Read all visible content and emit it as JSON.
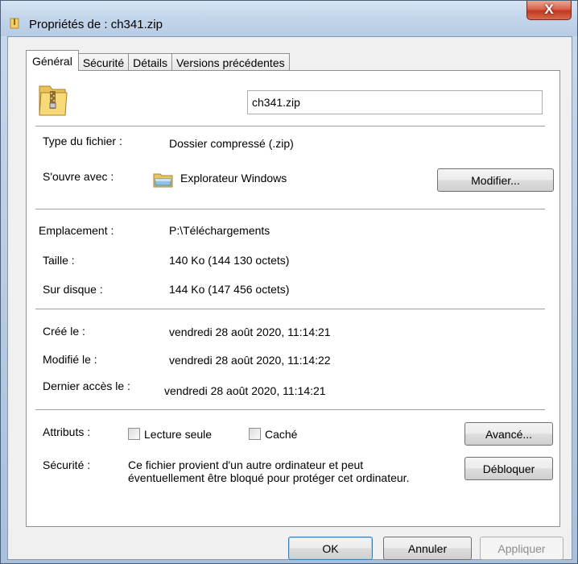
{
  "window": {
    "title": "Propriétés de : ch341.zip",
    "close_glyph": "X"
  },
  "tabs": [
    {
      "label": "Général",
      "active": true
    },
    {
      "label": "Sécurité",
      "active": false
    },
    {
      "label": "Détails",
      "active": false
    },
    {
      "label": "Versions précédentes",
      "active": false
    }
  ],
  "general": {
    "filename": "ch341.zip",
    "type_label": "Type du fichier :",
    "type_value": "Dossier compressé (.zip)",
    "opens_with_label": "S'ouvre avec :",
    "opens_with_value": "Explorateur Windows",
    "modify_button": "Modifier...",
    "location_label": "Emplacement :",
    "location_value": "P:\\Téléchargements",
    "size_label": "Taille :",
    "size_value": "140 Ko (144 130 octets)",
    "disk_label": "Sur disque :",
    "disk_value": "144 Ko (147 456 octets)",
    "created_label": "Créé le :",
    "created_value": "vendredi 28 août 2020, 11:14:21",
    "modified_label": "Modifié le :",
    "modified_value": "vendredi 28 août 2020, 11:14:22",
    "accessed_label": "Dernier accès le :",
    "accessed_value": "vendredi 28 août 2020, 11:14:21",
    "attributes_label": "Attributs :",
    "readonly_label": "Lecture seule",
    "readonly_checked": false,
    "hidden_label": "Caché",
    "hidden_checked": false,
    "advanced_button": "Avancé...",
    "security_label": "Sécurité :",
    "security_line1": "Ce fichier provient d'un autre ordinateur et peut",
    "security_line2": "éventuellement être bloqué pour protéger cet ordinateur.",
    "unblock_button": "Débloquer"
  },
  "footer": {
    "ok": "OK",
    "cancel": "Annuler",
    "apply": "Appliquer"
  },
  "colors": {
    "frame": "#b4c9e2",
    "close": "#c0391f",
    "dialog_bg": "#f0f0f0"
  }
}
